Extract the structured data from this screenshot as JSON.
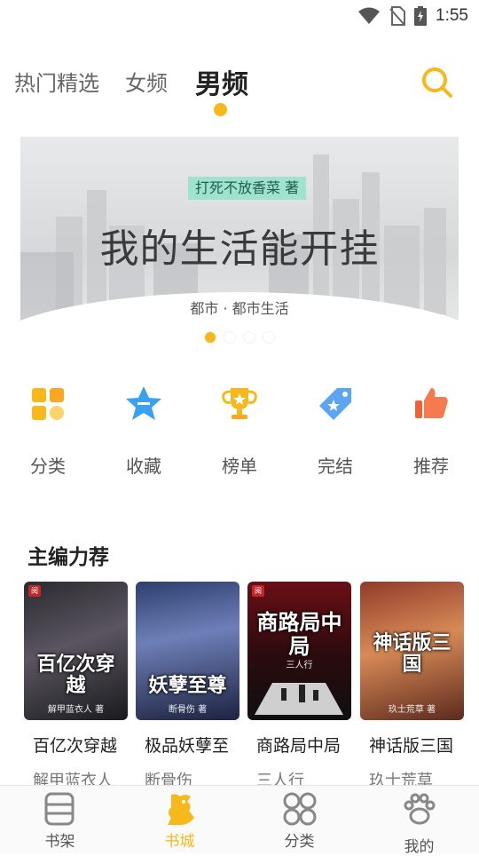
{
  "status_bar": {
    "time": "1:55"
  },
  "top_tabs": [
    {
      "label": "热门精选"
    },
    {
      "label": "女频"
    },
    {
      "label": "男频",
      "active": true
    }
  ],
  "banner": {
    "author_tag": "打死不放香菜 著",
    "title": "我的生活能开挂",
    "genre": "都市 · 都市生活",
    "slide_count": 4,
    "active_slide": 1
  },
  "quick_nav": [
    {
      "label": "分类",
      "icon": "category-icon"
    },
    {
      "label": "收藏",
      "icon": "star-collection-icon"
    },
    {
      "label": "榜单",
      "icon": "trophy-icon"
    },
    {
      "label": "完结",
      "icon": "tag-icon"
    },
    {
      "label": "推荐",
      "icon": "thumbs-up-icon"
    }
  ],
  "section": {
    "title": "主编力荐"
  },
  "books": [
    {
      "title": "百亿次穿越",
      "author": "解甲蓝衣人",
      "cover_text": "百亿次穿越",
      "cover_author": "解甲蓝衣人 著"
    },
    {
      "title": "极品妖孽至",
      "author": "断骨伤",
      "cover_text": "妖孽至尊",
      "cover_author": "断骨伤 著"
    },
    {
      "title": "商路局中局",
      "author": "三人行",
      "cover_text": "商路局中局",
      "cover_author": "三人行"
    },
    {
      "title": "神话版三国",
      "author": "玖士荒草",
      "cover_text": "神话版三国",
      "cover_author": "玖士荒草 著"
    }
  ],
  "bottom_nav": [
    {
      "label": "书架",
      "icon": "bookshelf-icon"
    },
    {
      "label": "书城",
      "icon": "bookstore-icon",
      "active": true
    },
    {
      "label": "分类",
      "icon": "category-grid-icon"
    },
    {
      "label": "我的",
      "icon": "paw-profile-icon"
    }
  ],
  "colors": {
    "accent": "#f6b81a",
    "text": "#222222"
  }
}
